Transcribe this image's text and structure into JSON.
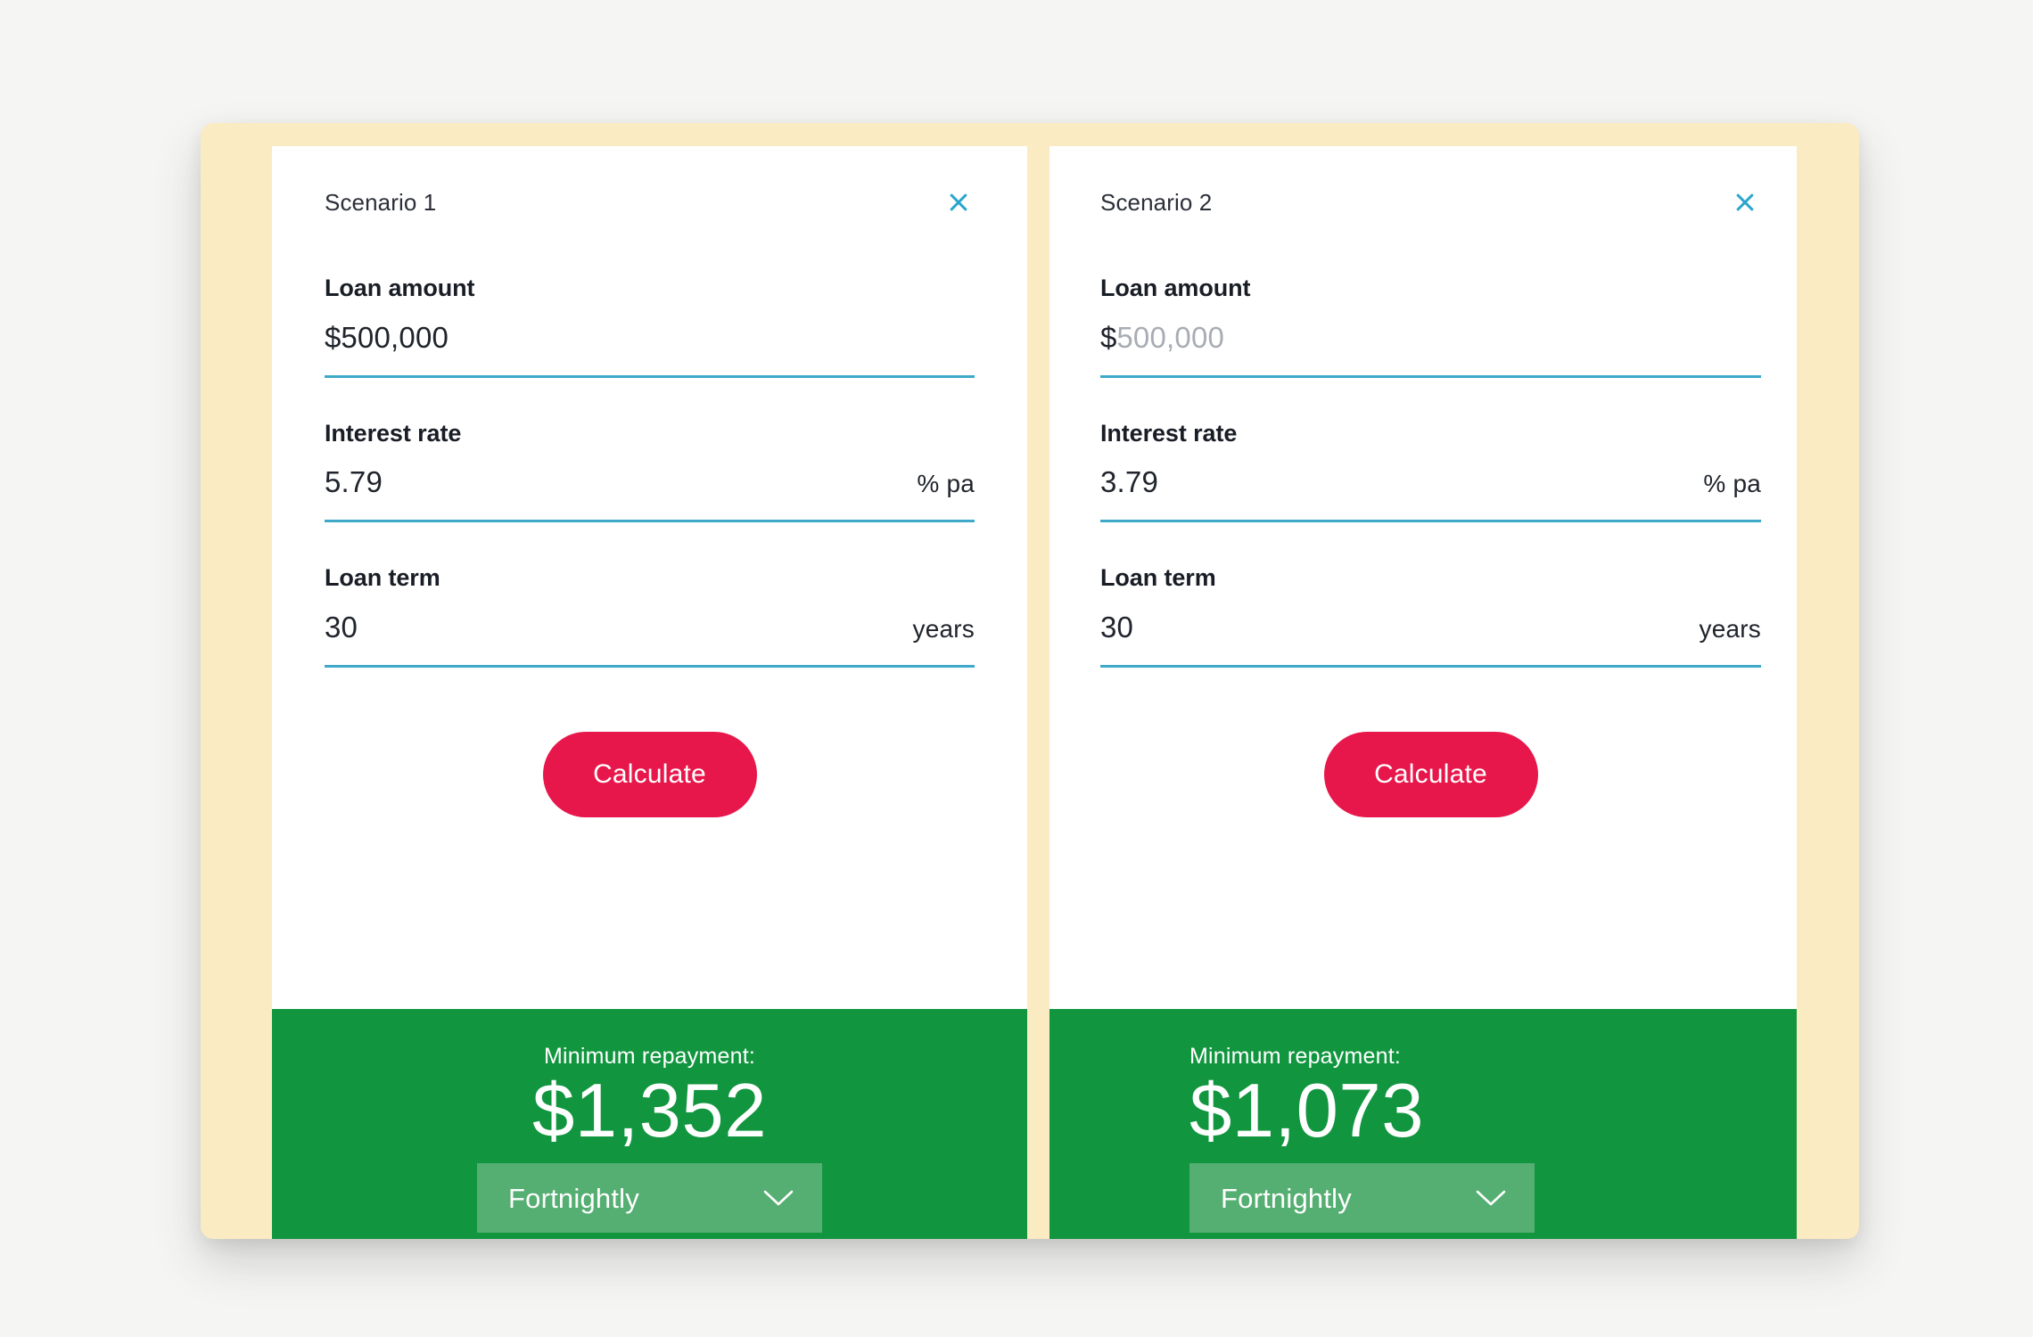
{
  "theme": {
    "canvas_bg": "#f5f5f3",
    "frame_bg": "#fbebc3",
    "card_bg": "#ffffff",
    "accent_underline": "#3fa9c9",
    "close_icon_color": "#2ba5cd",
    "calculate_bg": "#e8174b",
    "result_bg": "#11963f",
    "select_bg": "#55ae72",
    "label_color": "#191d26",
    "placeholder_color": "#a8adb4"
  },
  "scenarios": [
    {
      "title": "Scenario 1",
      "close_icon": "close-icon",
      "fields": {
        "loan_amount": {
          "label": "Loan amount",
          "prefix": "$",
          "value": "500,000",
          "placeholder": "500,000",
          "is_placeholder": false,
          "suffix": ""
        },
        "interest_rate": {
          "label": "Interest rate",
          "prefix": "",
          "value": "5.79",
          "placeholder": "5.79",
          "is_placeholder": false,
          "suffix": "% pa"
        },
        "loan_term": {
          "label": "Loan term",
          "prefix": "",
          "value": "30",
          "placeholder": "30",
          "is_placeholder": false,
          "suffix": "years"
        }
      },
      "calculate_label": "Calculate",
      "result": {
        "caption": "Minimum repayment:",
        "amount": "$1,352",
        "frequency": "Fortnightly",
        "frequency_icon": "chevron-down-icon"
      }
    },
    {
      "title": "Scenario 2",
      "close_icon": "close-icon",
      "fields": {
        "loan_amount": {
          "label": "Loan amount",
          "prefix": "$",
          "value": "500,000",
          "placeholder": "500,000",
          "is_placeholder": true,
          "suffix": ""
        },
        "interest_rate": {
          "label": "Interest rate",
          "prefix": "",
          "value": "3.79",
          "placeholder": "3.79",
          "is_placeholder": false,
          "suffix": "% pa"
        },
        "loan_term": {
          "label": "Loan term",
          "prefix": "",
          "value": "30",
          "placeholder": "30",
          "is_placeholder": false,
          "suffix": "years"
        }
      },
      "calculate_label": "Calculate",
      "result": {
        "caption": "Minimum repayment:",
        "amount": "$1,073",
        "frequency": "Fortnightly",
        "frequency_icon": "chevron-down-icon"
      }
    }
  ]
}
